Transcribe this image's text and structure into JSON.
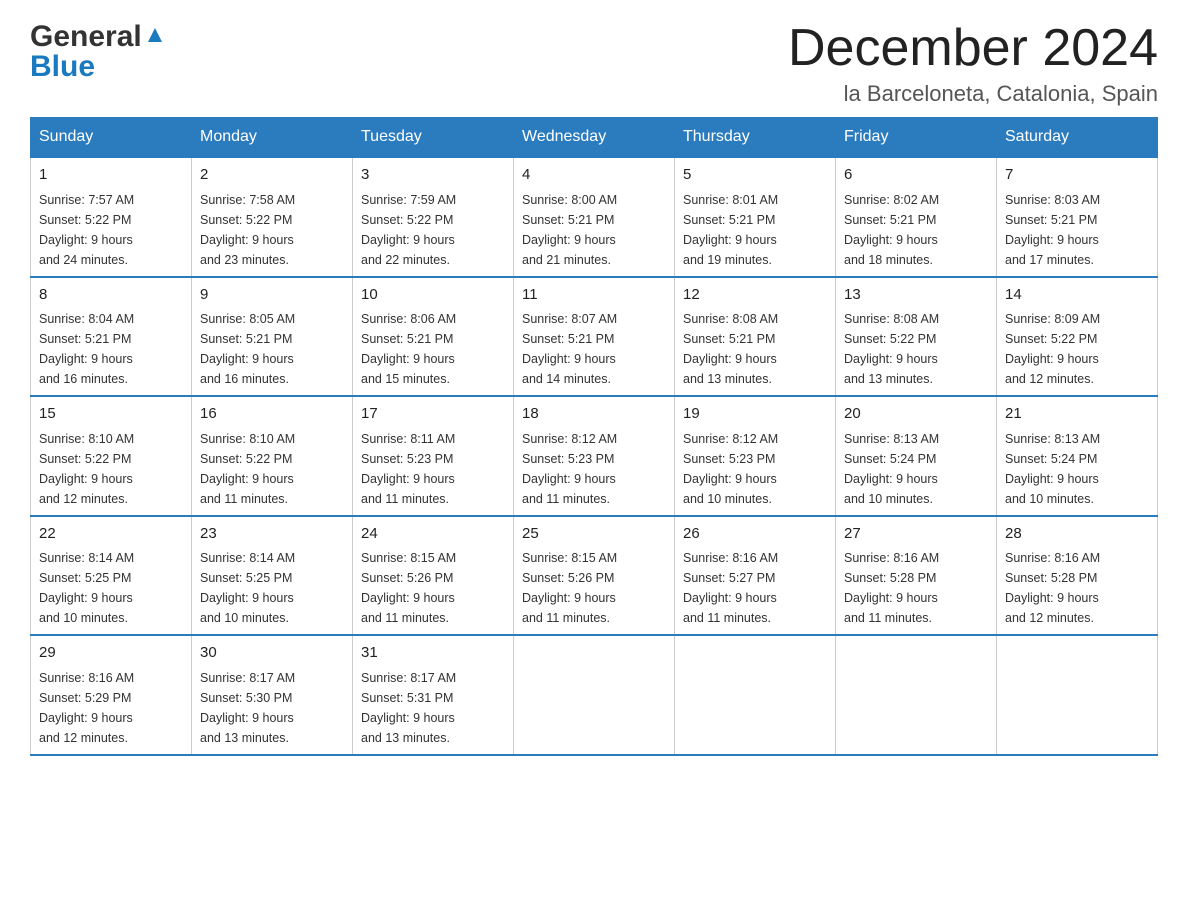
{
  "header": {
    "logo_general": "General",
    "logo_blue": "Blue",
    "title": "December 2024",
    "subtitle": "la Barceloneta, Catalonia, Spain"
  },
  "days_of_week": [
    "Sunday",
    "Monday",
    "Tuesday",
    "Wednesday",
    "Thursday",
    "Friday",
    "Saturday"
  ],
  "weeks": [
    [
      {
        "day": "1",
        "sunrise": "Sunrise: 7:57 AM",
        "sunset": "Sunset: 5:22 PM",
        "daylight": "Daylight: 9 hours",
        "daylight2": "and 24 minutes."
      },
      {
        "day": "2",
        "sunrise": "Sunrise: 7:58 AM",
        "sunset": "Sunset: 5:22 PM",
        "daylight": "Daylight: 9 hours",
        "daylight2": "and 23 minutes."
      },
      {
        "day": "3",
        "sunrise": "Sunrise: 7:59 AM",
        "sunset": "Sunset: 5:22 PM",
        "daylight": "Daylight: 9 hours",
        "daylight2": "and 22 minutes."
      },
      {
        "day": "4",
        "sunrise": "Sunrise: 8:00 AM",
        "sunset": "Sunset: 5:21 PM",
        "daylight": "Daylight: 9 hours",
        "daylight2": "and 21 minutes."
      },
      {
        "day": "5",
        "sunrise": "Sunrise: 8:01 AM",
        "sunset": "Sunset: 5:21 PM",
        "daylight": "Daylight: 9 hours",
        "daylight2": "and 19 minutes."
      },
      {
        "day": "6",
        "sunrise": "Sunrise: 8:02 AM",
        "sunset": "Sunset: 5:21 PM",
        "daylight": "Daylight: 9 hours",
        "daylight2": "and 18 minutes."
      },
      {
        "day": "7",
        "sunrise": "Sunrise: 8:03 AM",
        "sunset": "Sunset: 5:21 PM",
        "daylight": "Daylight: 9 hours",
        "daylight2": "and 17 minutes."
      }
    ],
    [
      {
        "day": "8",
        "sunrise": "Sunrise: 8:04 AM",
        "sunset": "Sunset: 5:21 PM",
        "daylight": "Daylight: 9 hours",
        "daylight2": "and 16 minutes."
      },
      {
        "day": "9",
        "sunrise": "Sunrise: 8:05 AM",
        "sunset": "Sunset: 5:21 PM",
        "daylight": "Daylight: 9 hours",
        "daylight2": "and 16 minutes."
      },
      {
        "day": "10",
        "sunrise": "Sunrise: 8:06 AM",
        "sunset": "Sunset: 5:21 PM",
        "daylight": "Daylight: 9 hours",
        "daylight2": "and 15 minutes."
      },
      {
        "day": "11",
        "sunrise": "Sunrise: 8:07 AM",
        "sunset": "Sunset: 5:21 PM",
        "daylight": "Daylight: 9 hours",
        "daylight2": "and 14 minutes."
      },
      {
        "day": "12",
        "sunrise": "Sunrise: 8:08 AM",
        "sunset": "Sunset: 5:21 PM",
        "daylight": "Daylight: 9 hours",
        "daylight2": "and 13 minutes."
      },
      {
        "day": "13",
        "sunrise": "Sunrise: 8:08 AM",
        "sunset": "Sunset: 5:22 PM",
        "daylight": "Daylight: 9 hours",
        "daylight2": "and 13 minutes."
      },
      {
        "day": "14",
        "sunrise": "Sunrise: 8:09 AM",
        "sunset": "Sunset: 5:22 PM",
        "daylight": "Daylight: 9 hours",
        "daylight2": "and 12 minutes."
      }
    ],
    [
      {
        "day": "15",
        "sunrise": "Sunrise: 8:10 AM",
        "sunset": "Sunset: 5:22 PM",
        "daylight": "Daylight: 9 hours",
        "daylight2": "and 12 minutes."
      },
      {
        "day": "16",
        "sunrise": "Sunrise: 8:10 AM",
        "sunset": "Sunset: 5:22 PM",
        "daylight": "Daylight: 9 hours",
        "daylight2": "and 11 minutes."
      },
      {
        "day": "17",
        "sunrise": "Sunrise: 8:11 AM",
        "sunset": "Sunset: 5:23 PM",
        "daylight": "Daylight: 9 hours",
        "daylight2": "and 11 minutes."
      },
      {
        "day": "18",
        "sunrise": "Sunrise: 8:12 AM",
        "sunset": "Sunset: 5:23 PM",
        "daylight": "Daylight: 9 hours",
        "daylight2": "and 11 minutes."
      },
      {
        "day": "19",
        "sunrise": "Sunrise: 8:12 AM",
        "sunset": "Sunset: 5:23 PM",
        "daylight": "Daylight: 9 hours",
        "daylight2": "and 10 minutes."
      },
      {
        "day": "20",
        "sunrise": "Sunrise: 8:13 AM",
        "sunset": "Sunset: 5:24 PM",
        "daylight": "Daylight: 9 hours",
        "daylight2": "and 10 minutes."
      },
      {
        "day": "21",
        "sunrise": "Sunrise: 8:13 AM",
        "sunset": "Sunset: 5:24 PM",
        "daylight": "Daylight: 9 hours",
        "daylight2": "and 10 minutes."
      }
    ],
    [
      {
        "day": "22",
        "sunrise": "Sunrise: 8:14 AM",
        "sunset": "Sunset: 5:25 PM",
        "daylight": "Daylight: 9 hours",
        "daylight2": "and 10 minutes."
      },
      {
        "day": "23",
        "sunrise": "Sunrise: 8:14 AM",
        "sunset": "Sunset: 5:25 PM",
        "daylight": "Daylight: 9 hours",
        "daylight2": "and 10 minutes."
      },
      {
        "day": "24",
        "sunrise": "Sunrise: 8:15 AM",
        "sunset": "Sunset: 5:26 PM",
        "daylight": "Daylight: 9 hours",
        "daylight2": "and 11 minutes."
      },
      {
        "day": "25",
        "sunrise": "Sunrise: 8:15 AM",
        "sunset": "Sunset: 5:26 PM",
        "daylight": "Daylight: 9 hours",
        "daylight2": "and 11 minutes."
      },
      {
        "day": "26",
        "sunrise": "Sunrise: 8:16 AM",
        "sunset": "Sunset: 5:27 PM",
        "daylight": "Daylight: 9 hours",
        "daylight2": "and 11 minutes."
      },
      {
        "day": "27",
        "sunrise": "Sunrise: 8:16 AM",
        "sunset": "Sunset: 5:28 PM",
        "daylight": "Daylight: 9 hours",
        "daylight2": "and 11 minutes."
      },
      {
        "day": "28",
        "sunrise": "Sunrise: 8:16 AM",
        "sunset": "Sunset: 5:28 PM",
        "daylight": "Daylight: 9 hours",
        "daylight2": "and 12 minutes."
      }
    ],
    [
      {
        "day": "29",
        "sunrise": "Sunrise: 8:16 AM",
        "sunset": "Sunset: 5:29 PM",
        "daylight": "Daylight: 9 hours",
        "daylight2": "and 12 minutes."
      },
      {
        "day": "30",
        "sunrise": "Sunrise: 8:17 AM",
        "sunset": "Sunset: 5:30 PM",
        "daylight": "Daylight: 9 hours",
        "daylight2": "and 13 minutes."
      },
      {
        "day": "31",
        "sunrise": "Sunrise: 8:17 AM",
        "sunset": "Sunset: 5:31 PM",
        "daylight": "Daylight: 9 hours",
        "daylight2": "and 13 minutes."
      },
      null,
      null,
      null,
      null
    ]
  ]
}
